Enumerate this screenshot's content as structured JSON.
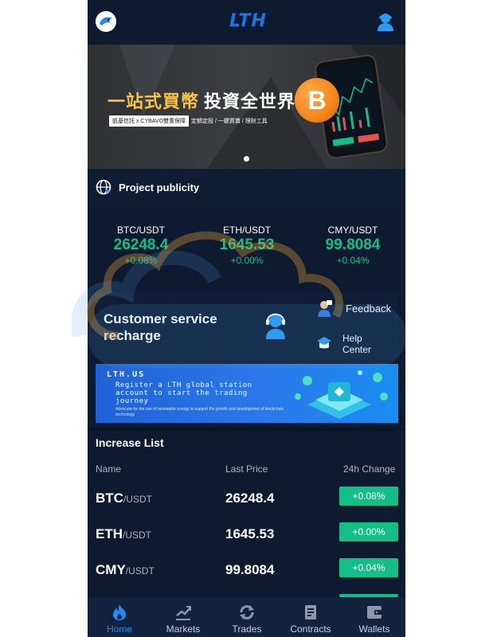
{
  "header": {
    "logo_text": "LTH",
    "avatar_icon": "dolphin-avatar-icon",
    "user_icon": "user-support-icon",
    "accent": "#1677e6"
  },
  "banner": {
    "title_gold": "一站式買幣",
    "title_white": "投資全世界",
    "sub_tag": "凱基信託 x CYBAVO雙重保障",
    "sub_text": "定額定投 / 一鍵買賣 / 理財工具",
    "coin_symbol": "B",
    "active_slide": 1,
    "slide_count": 1
  },
  "publicity": {
    "label": "Project publicity",
    "icon": "globe-icon"
  },
  "tickers": [
    {
      "pair": "BTC/USDT",
      "price": "26248.4",
      "change": "+0.08%"
    },
    {
      "pair": "ETH/USDT",
      "price": "1645.53",
      "change": "+0.00%"
    },
    {
      "pair": "CMY/USDT",
      "price": "99.8084",
      "change": "+0.04%"
    }
  ],
  "service": {
    "title": "Customer service recharge",
    "feedback": "Feedback",
    "help": "Help Center"
  },
  "promo": {
    "brand": "LTH.US",
    "text": "Register a LTH global station account to start the trading journey",
    "small": "Advocate for the use of renewable energy to support the growth and development of blockchain technology"
  },
  "increase_list": {
    "title": "Increase List",
    "col_name": "Name",
    "col_price": "Last Price",
    "col_change": "24h Change",
    "rows": [
      {
        "base": "BTC",
        "quote": "/USDT",
        "price": "26248.4",
        "change": "+0.08%"
      },
      {
        "base": "ETH",
        "quote": "/USDT",
        "price": "1645.53",
        "change": "+0.00%"
      },
      {
        "base": "CMY",
        "quote": "/USDT",
        "price": "99.8084",
        "change": "+0.04%"
      }
    ],
    "up_color": "#13bf87"
  },
  "tabbar": {
    "items": [
      {
        "label": "Home",
        "icon": "flame-icon",
        "active": true
      },
      {
        "label": "Markets",
        "icon": "chart-icon",
        "active": false
      },
      {
        "label": "Trades",
        "icon": "refresh-icon",
        "active": false
      },
      {
        "label": "Contracts",
        "icon": "document-icon",
        "active": false
      },
      {
        "label": "Wallets",
        "icon": "wallet-icon",
        "active": false
      }
    ],
    "active_color": "#1e8ef5"
  }
}
